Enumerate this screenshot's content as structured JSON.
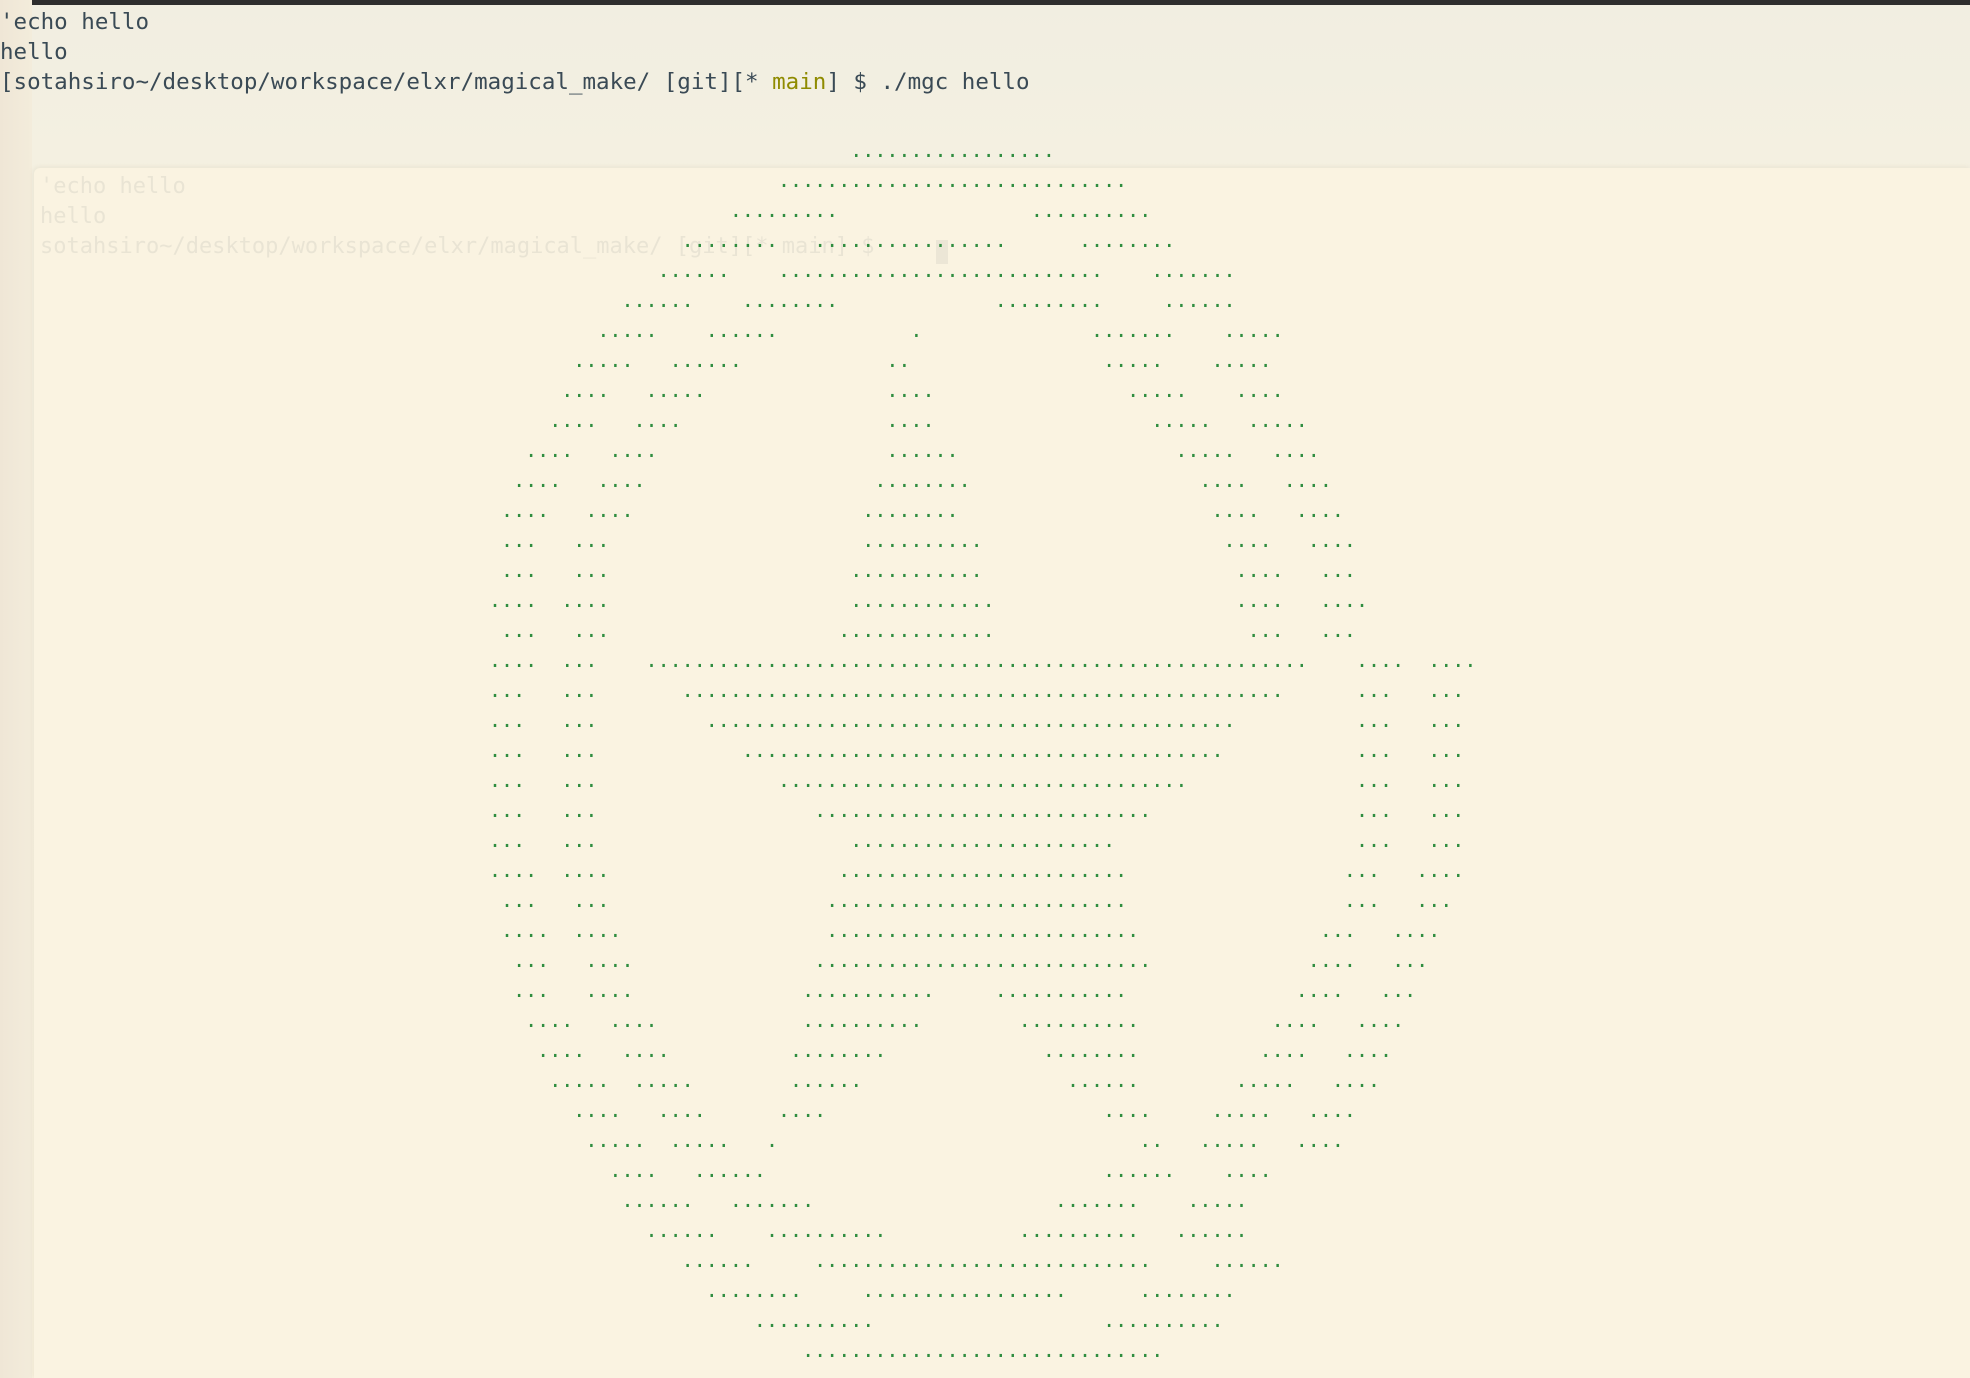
{
  "terminal": {
    "command_echo": "'echo hello",
    "echo_output": "hello",
    "prompt_path": "[sotahsiro~/desktop/workspace/elxr/magical_make/",
    "prompt_git": "[git][*",
    "prompt_branch": "main",
    "prompt_end": "] $",
    "command": "./mgc hello"
  },
  "ghost_window": {
    "line1": "'echo hello",
    "line2": "hello",
    "line3": "sotahsiro~/desktop/workspace/elxr/magical_make/ [git][* main] $"
  },
  "ascii_art": {
    "color": "#2f8d3f",
    "lines": [
      "                              .................                        ",
      "                        .............................                  ",
      "                    .........                ..........                ",
      "                ........   ................      ........              ",
      "              ......    ...........................    .......          ",
      "           ......    ........             .........     ......         ",
      "         .....    ......           .              .......    .....     ",
      "       .....   ......            ..                .....    .....     ",
      "      ....   .....               ....                .....    ....    ",
      "     ....   ....                 ....                  .....   .....  ",
      "   ....   ....                   ......                  .....   ....  ",
      "  ....   ....                   ........                   ....   .... ",
      " ....   ....                   ........                     ....   ....",
      " ...   ...                     ..........                    ....   ....",
      " ...   ...                    ...........                     ....   ...",
      "....  ....                    ............                    ....   ....",
      " ...   ...                   .............                     ...   ...",
      "....  ...    .......................................................    ....  ....",
      "...   ...       ..................................................      ...   ...",
      "...   ...         ............................................          ...   ...",
      "...   ...            ........................................           ...   ...",
      "...   ...               ..................................              ...   ...",
      "...   ...                  ............................                 ...   ...",
      "...   ...                     ......................                    ...   ...",
      "....  ....                   ........................                  ...   ....",
      " ...   ...                  .........................                  ...   ...",
      " ....  ....                 ..........................               ...   ....",
      "  ...   ....               ............................             ....   ...",
      "  ...   ....              ...........     ...........              ....   ...",
      "   ....   ....            ..........        ..........           ....   ....",
      "    ....   ....          ........             ........          ....   ....",
      "     .....  .....        ......                 ......        .....   ....",
      "       ....   ....      ....                       ....     .....   ....",
      "        .....  .....   .                              ..   .....   ....",
      "          ....   ......                            ......    ....",
      "           ......   .......                    .......    .....",
      "             ......    ..........           ..........   ......",
      "                ......     ............................     ......",
      "                  ........     .................      ........",
      "                      ..........                   ..........",
      "                          .............................."
    ]
  }
}
